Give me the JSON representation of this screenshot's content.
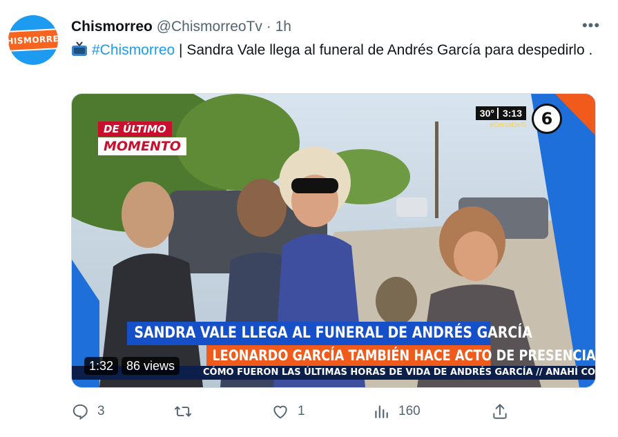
{
  "tweet": {
    "display_name": "Chismorreo",
    "handle": "@ChismorreoTv",
    "separator": "·",
    "time": "1h",
    "more_label": "•••",
    "hashtag": "#Chismorreo",
    "text": " | Sandra Vale llega al funeral de Andrés García para despedirlo ."
  },
  "avatar": {
    "logo_text": "CHISMORREO"
  },
  "video": {
    "breaking_line1": "DE ÚLTIMO",
    "breaking_line2": "MOMENTO",
    "temperature": "30°",
    "clock": "3:13",
    "channel_hashtag": "#CercaDeTi",
    "channel_number": "6",
    "headline": "SANDRA VALE LLEGA AL FUNERAL DE ANDRÉS GARCÍA",
    "subheadline": "LEONARDO GARCÍA TAMBIÉN HACE ACTO DE PRESENCIA",
    "ticker": "CÓMO FUERON LAS ÚLTIMAS HORAS DE VIDA DE ANDRÉS GARCÍA   //   ANAHÍ CONSTERNADA POR LA",
    "duration": "1:32",
    "views": "86 views"
  },
  "actions": {
    "replies": "3",
    "retweets": "",
    "likes": "1",
    "views": "160"
  },
  "colors": {
    "link": "#1d9bf0",
    "muted": "#536471"
  }
}
